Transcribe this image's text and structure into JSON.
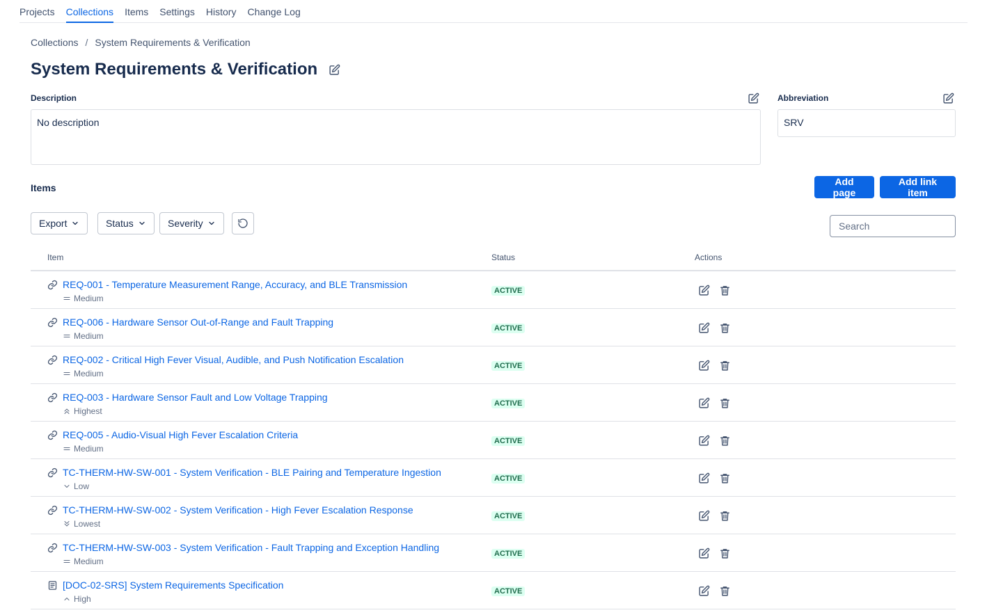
{
  "nav": {
    "tabs": [
      {
        "label": "Projects"
      },
      {
        "label": "Collections"
      },
      {
        "label": "Items"
      },
      {
        "label": "Settings"
      },
      {
        "label": "History"
      },
      {
        "label": "Change Log"
      }
    ],
    "active": "Collections"
  },
  "breadcrumb": {
    "root": "Collections",
    "separator": "/",
    "current": "System Requirements & Verification"
  },
  "page": {
    "title": "System Requirements & Verification"
  },
  "description": {
    "label": "Description",
    "value": "No description"
  },
  "abbreviation": {
    "label": "Abbreviation",
    "value": "SRV"
  },
  "items_section": {
    "title": "Items",
    "add_page_label": "Add page",
    "add_link_label": "Add link item"
  },
  "filters": {
    "export_label": "Export",
    "status_label": "Status",
    "severity_label": "Severity",
    "search_placeholder": "Search"
  },
  "table": {
    "headers": {
      "item": "Item",
      "status": "Status",
      "actions": "Actions"
    },
    "rows": [
      {
        "type": "link-icon",
        "title": "REQ-001 - Temperature Measurement Range, Accuracy, and BLE Transmission",
        "severity": "Medium",
        "severity_icon": "equals-icon",
        "status": "ACTIVE"
      },
      {
        "type": "link-icon",
        "title": "REQ-006 - Hardware Sensor Out-of-Range and Fault Trapping",
        "severity": "Medium",
        "severity_icon": "equals-icon",
        "status": "ACTIVE"
      },
      {
        "type": "link-icon",
        "title": "REQ-002 - Critical High Fever Visual, Audible, and Push Notification Escalation",
        "severity": "Medium",
        "severity_icon": "equals-icon",
        "status": "ACTIVE"
      },
      {
        "type": "link-icon",
        "title": "REQ-003 - Hardware Sensor Fault and Low Voltage Trapping",
        "severity": "Highest",
        "severity_icon": "double-chevron-up-icon",
        "status": "ACTIVE"
      },
      {
        "type": "link-icon",
        "title": "REQ-005 - Audio-Visual High Fever Escalation Criteria",
        "severity": "Medium",
        "severity_icon": "equals-icon",
        "status": "ACTIVE"
      },
      {
        "type": "link-icon",
        "title": "TC-THERM-HW-SW-001 - System Verification - BLE Pairing and Temperature Ingestion",
        "severity": "Low",
        "severity_icon": "chevron-down-icon",
        "status": "ACTIVE"
      },
      {
        "type": "link-icon",
        "title": "TC-THERM-HW-SW-002 - System Verification - High Fever Escalation Response",
        "severity": "Lowest",
        "severity_icon": "double-chevron-down-icon",
        "status": "ACTIVE"
      },
      {
        "type": "link-icon",
        "title": "TC-THERM-HW-SW-003 - System Verification - Fault Trapping and Exception Handling",
        "severity": "Medium",
        "severity_icon": "equals-icon",
        "status": "ACTIVE"
      },
      {
        "type": "page-icon",
        "title": "[DOC-02-SRS] System Requirements Specification",
        "severity": "High",
        "severity_icon": "chevron-up-icon",
        "status": "ACTIVE"
      }
    ]
  },
  "colors": {
    "accent": "#0c66e4",
    "status_bg": "#dcfff1",
    "status_text": "#216e4e"
  }
}
